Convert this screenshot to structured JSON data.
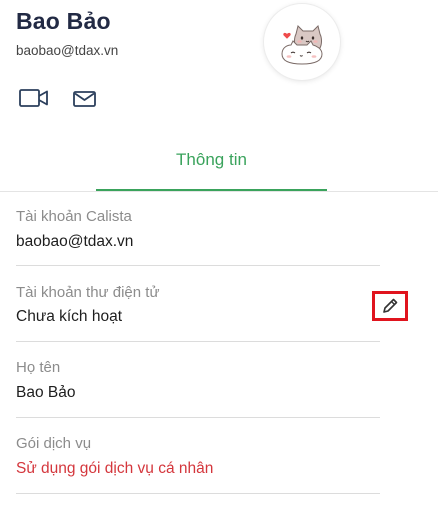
{
  "profile": {
    "name": "Bao Bảo",
    "email": "baobao@tdax.vn",
    "avatar_icon": "cat-couple-avatar",
    "actions": [
      {
        "icon": "video-call-icon"
      },
      {
        "icon": "mail-icon"
      }
    ]
  },
  "tabs": [
    {
      "label": "Thông tin",
      "active": true
    }
  ],
  "info": {
    "calista_account": {
      "label": "Tài khoản Calista",
      "value": "baobao@tdax.vn"
    },
    "email_account": {
      "label": "Tài khoản thư điện tử",
      "value": "Chưa kích hoạt",
      "edit_icon": "pencil-icon"
    },
    "full_name": {
      "label": "Họ tên",
      "value": "Bao Bảo"
    },
    "service_plan": {
      "label": "Gói dịch vụ",
      "value": "Sử dụng gói dịch vụ cá nhân"
    }
  },
  "colors": {
    "accent": "#3aa35c",
    "name_text": "#222a44",
    "warning_text": "#d4363c",
    "highlight_border": "#e0141e",
    "label_text": "#8c8c8c"
  }
}
